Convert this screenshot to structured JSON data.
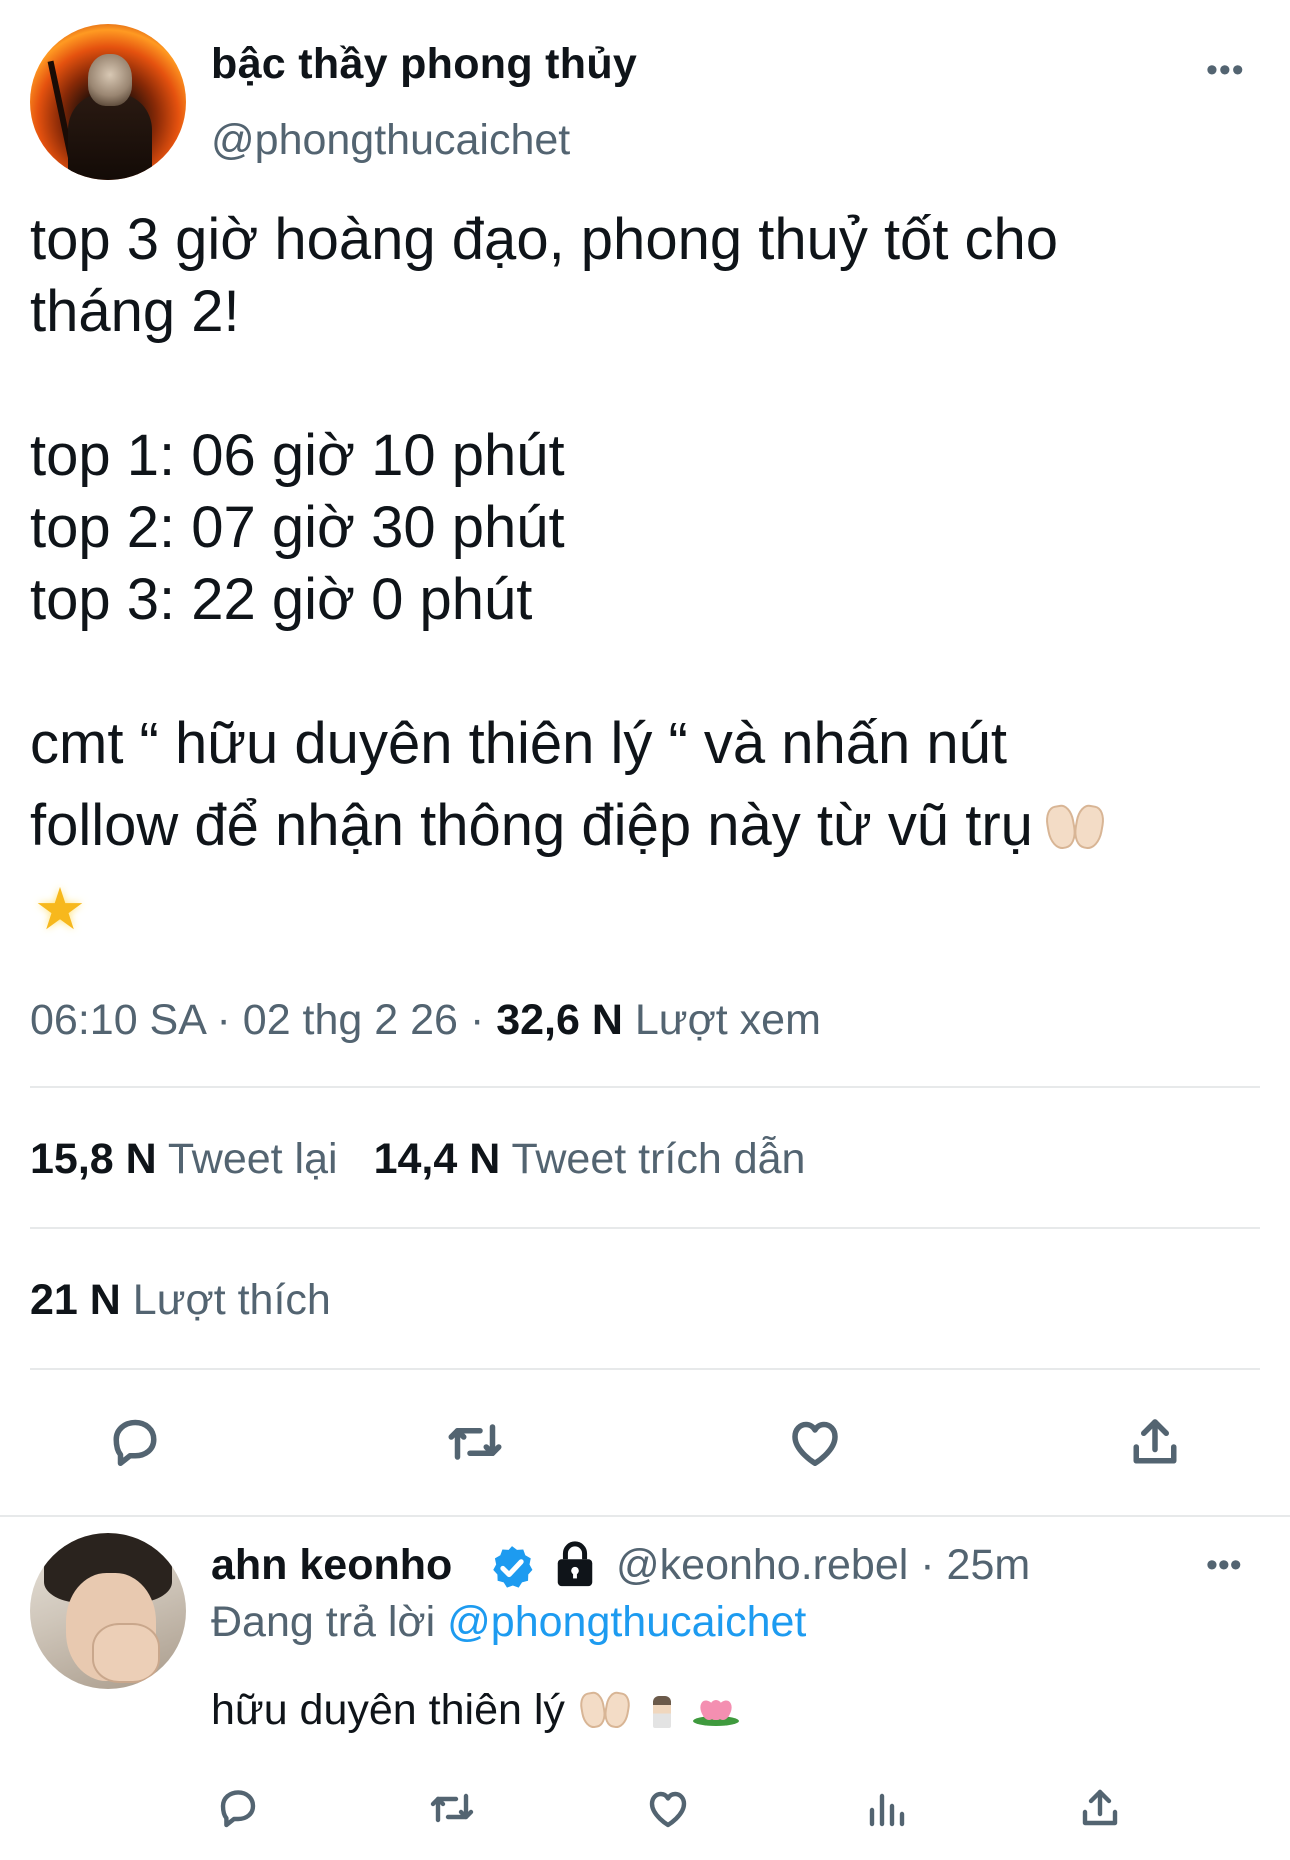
{
  "tweet": {
    "author_name": "bậc thầy phong thủy",
    "author_handle": "@phongthucaichet",
    "more_label": "•••",
    "text_lines": [
      "top 3 giờ hoàng đạo, phong thuỷ tốt cho",
      "tháng 2!",
      "top 1: 06 giờ 10 phút",
      "top 2: 07 giờ 30 phút",
      "top 3: 22 giờ 0 phút",
      "cmt “ hữu duyên thiên lý “ và nhấn nút",
      "follow để nhận thông điệp này từ vũ trụ"
    ],
    "time": "06:10 SA",
    "date": "02 thg 2 26",
    "separator": "·",
    "views_count": "32,6 N",
    "views_label": "Lượt xem",
    "retweets_count": "15,8 N",
    "retweets_label": "Tweet lại",
    "quotes_count": "14,4 N",
    "quotes_label": "Tweet trích dẫn",
    "likes_count": "21 N",
    "likes_label": "Lượt thích",
    "icons": [
      "reply-icon",
      "retweet-icon",
      "like-icon",
      "share-icon",
      "raised-hands-emoji",
      "glowing-star-emoji"
    ]
  },
  "reply": {
    "author_name": "ahn keonho",
    "author_handle": "@keonho.rebel",
    "separator": "·",
    "time_ago": "25m",
    "more_label": "•••",
    "replying_prefix": "Đang trả lời",
    "replying_mention": "@phongthucaichet",
    "text": "hữu duyên thiên lý",
    "icons": [
      "verified-badge-icon",
      "lock-icon",
      "raised-hands-emoji",
      "person-praying-emoji",
      "lotus-emoji",
      "reply-icon",
      "retweet-icon",
      "like-icon",
      "analytics-icon",
      "share-icon"
    ]
  },
  "colors": {
    "text": "#0f1419",
    "secondary": "#536471",
    "link": "#1d9bf0",
    "divider": "#e7e9ea"
  }
}
